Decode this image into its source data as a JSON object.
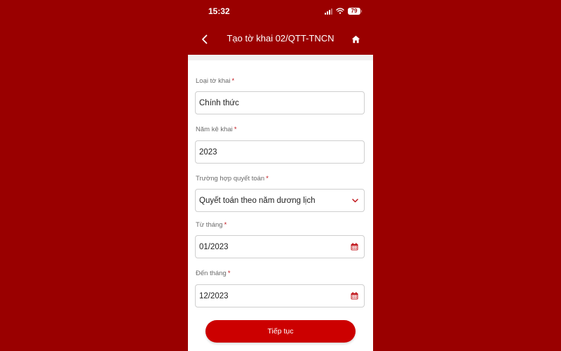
{
  "status_bar": {
    "time": "15:32",
    "battery": "79",
    "icons": [
      "signal-icon",
      "wifi-icon",
      "battery-icon"
    ]
  },
  "nav": {
    "title": "Tạo tờ khai 02/QTT-TNCN",
    "back_icon": "chevron-left-icon",
    "home_icon": "home-icon"
  },
  "form": {
    "required_marker": "*",
    "fields": [
      {
        "label": "Loại tờ khai",
        "value": "Chính thức",
        "type": "text"
      },
      {
        "label": "Năm kê khai",
        "value": "2023",
        "type": "text"
      },
      {
        "label": "Trường hợp quyết toán",
        "value": "Quyết toán theo năm dương lịch",
        "type": "select",
        "icon": "chevron-down-icon"
      },
      {
        "label": "Từ tháng",
        "value": "01/2023",
        "type": "date",
        "icon": "calendar-icon"
      },
      {
        "label": "Đến tháng",
        "value": "12/2023",
        "type": "date",
        "icon": "calendar-icon"
      }
    ],
    "submit_label": "Tiếp tục"
  },
  "colors": {
    "brand_red": "#9a0000",
    "button_red": "#cc0000",
    "required_red": "#c0151b",
    "content_bg": "#ffffff"
  }
}
